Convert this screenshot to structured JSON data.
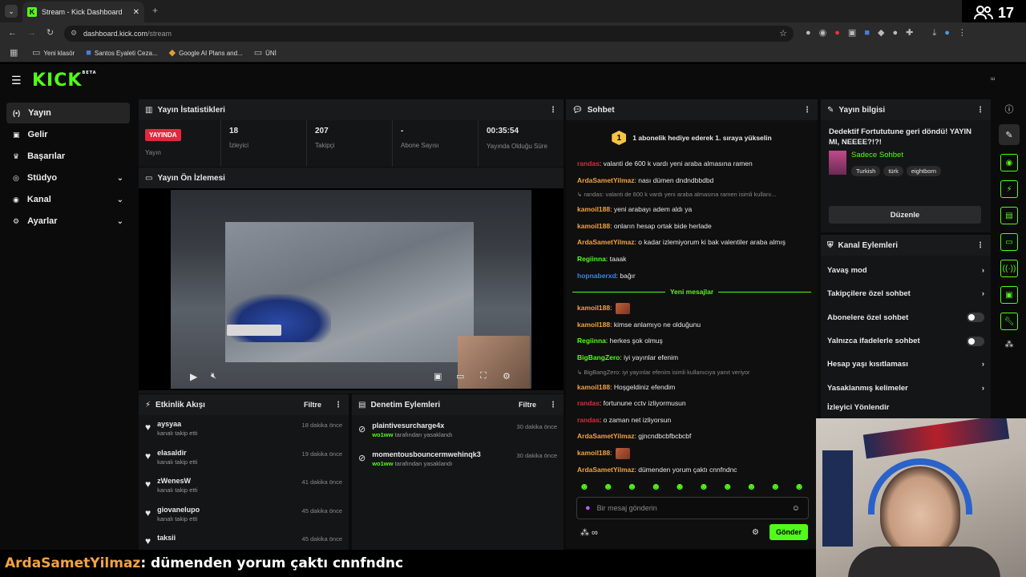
{
  "browser": {
    "tab_title": "Stream - Kick Dashboard",
    "url_domain": "dashboard.kick.com",
    "url_path": "/stream",
    "bookmarks": [
      "Yeni klasör",
      "Santos Eyaleti Ceza...",
      "Google AI Plans and...",
      "ÜNİ"
    ],
    "overlay_viewers": "17"
  },
  "sidebar": {
    "items": [
      {
        "label": "Yayın",
        "icon": "broadcast-icon"
      },
      {
        "label": "Gelir",
        "icon": "money-icon"
      },
      {
        "label": "Başarılar",
        "icon": "trophy-icon"
      },
      {
        "label": "Stüdyo",
        "icon": "studio-icon"
      },
      {
        "label": "Kanal",
        "icon": "channel-icon"
      },
      {
        "label": "Ayarlar",
        "icon": "gear-icon"
      }
    ]
  },
  "stats": {
    "title": "Yayın İstatistikleri",
    "live_badge": "YAYINDA",
    "live_label": "Yayın",
    "viewers_value": "18",
    "viewers_label": "İzleyici",
    "followers_value": "207",
    "followers_label": "Takipçi",
    "subs_value": "-",
    "subs_label": "Abone Sayısı",
    "time_value": "00:35:54",
    "time_label": "Yayında Olduğu Süre"
  },
  "preview": {
    "title": "Yayın Ön İzlemesi"
  },
  "events": {
    "title": "Etkinlik Akışı",
    "filter_label": "Filtre",
    "items": [
      {
        "user": "aysyaa",
        "action": "kanalı takip etti",
        "time": "18 dakika önce"
      },
      {
        "user": "elasaldir",
        "action": "kanalı takip etti",
        "time": "19 dakika önce"
      },
      {
        "user": "zWenesW",
        "action": "kanalı takip etti",
        "time": "41 dakika önce"
      },
      {
        "user": "giovanelupo",
        "action": "kanalı takip etti",
        "time": "45 dakika önce"
      },
      {
        "user": "taksii",
        "action": "",
        "time": "45 dakika önce"
      }
    ]
  },
  "moderation": {
    "title": "Denetim Eylemleri",
    "filter_label": "Filtre",
    "items": [
      {
        "user": "plaintivesurcharge4x",
        "by": "wo1ww",
        "action": "tarafından yasaklandı",
        "time": "30 dakika önce"
      },
      {
        "user": "momentousbouncermwehinqk3",
        "by": "wo1ww",
        "action": "tarafından yasaklandı",
        "time": "30 dakika önce"
      }
    ]
  },
  "chat": {
    "title": "Sohbet",
    "pinned": "1 abonelik hediye ederek 1. sıraya yükselin",
    "pinned_rank": "1",
    "new_messages_label": "Yeni mesajlar",
    "input_placeholder": "Bir mesaj gönderin",
    "send_label": "Gönder",
    "messages_before": [
      {
        "user": "randas",
        "color": "#e3283e",
        "text": ": valanti de 600 k vardı yeni araba almasına ramen"
      },
      {
        "user": "ArdaSametYilmaz",
        "color": "#f2a341",
        "text": ": nası dümen dndndbbdbd"
      },
      {
        "reply": "randas: valanti de 600 k vardı yeni araba almasına ramen isimli kullanı..."
      },
      {
        "user": "kamoil188",
        "color": "#f2a341",
        "text": ": yeni arabayı adem aldı ya"
      },
      {
        "user": "kamoil188",
        "color": "#f2a341",
        "text": ": onların hesap ortak bide herlade"
      },
      {
        "user": "ArdaSametYilmaz",
        "color": "#f2a341",
        "text": ": o kadar izlemiyorum ki bak valentiler araba almış"
      },
      {
        "user": "Regiinna",
        "color": "#53fc18",
        "text": ": taaak"
      },
      {
        "user": "hopnaberxd",
        "color": "#3b82f6",
        "text": ": bağır"
      }
    ],
    "messages_after": [
      {
        "user": "kamoil188",
        "color": "#f2a341",
        "text": ":",
        "emote": true
      },
      {
        "user": "kamoil188",
        "color": "#f2a341",
        "text": ": kimse anlamıyo ne olduğunu"
      },
      {
        "user": "Regiinna",
        "color": "#53fc18",
        "text": ": herkes şok olmuş"
      },
      {
        "user": "BigBangZero",
        "color": "#53fc18",
        "text": ": iyi yayınlar efenim"
      },
      {
        "reply": "BigBangZero: iyi yayınlar efenim isimli kullanıcıya yanıt veriyor"
      },
      {
        "user": "kamoil188",
        "color": "#f2a341",
        "text": ": Hoşgeldiniz efendim"
      },
      {
        "user": "randas",
        "color": "#e3283e",
        "text": ": fortunune cctv izliyormusun"
      },
      {
        "user": "randas",
        "color": "#e3283e",
        "text": ": o zaman net izliyorsun"
      },
      {
        "user": "ArdaSametYilmaz",
        "color": "#f2a341",
        "text": ": gjncndbcbfbcbcbf"
      },
      {
        "user": "kamoil188",
        "color": "#f2a341",
        "text": ":",
        "emote": true
      },
      {
        "user": "ArdaSametYilmaz",
        "color": "#f2a341",
        "text": ": dümenden yorum çaktı cnnfndnc"
      }
    ]
  },
  "stream_info": {
    "title": "Yayın bilgisi",
    "stream_title": "Dedektif Fortututune geri döndü! YAYIN MI, NEEEE?!?!",
    "category": "Sadece Sohbet",
    "tags": [
      "Turkish",
      "türk",
      "eightborn"
    ],
    "edit_label": "Düzenle"
  },
  "channel_actions": {
    "title": "Kanal Eylemleri",
    "items": [
      {
        "label": "Yavaş mod",
        "control": "chevron"
      },
      {
        "label": "Takipçilere özel sohbet",
        "control": "chevron"
      },
      {
        "label": "Abonelere özel sohbet",
        "control": "toggle"
      },
      {
        "label": "Yalnızca ifadelerle sohbet",
        "control": "toggle"
      },
      {
        "label": "Hesap yaşı kısıtlaması",
        "control": "chevron"
      },
      {
        "label": "Yasaklanmış kelimeler",
        "control": "chevron"
      },
      {
        "label": "İzleyici Yönlendir",
        "control": "none"
      }
    ]
  },
  "caption": {
    "user": "ArdaSametYilmaz",
    "text": " : dümenden yorum çaktı cnnfndnc"
  },
  "colors": {
    "accent": "#53fc18",
    "live": "#e3283e",
    "panel": "#141517"
  }
}
